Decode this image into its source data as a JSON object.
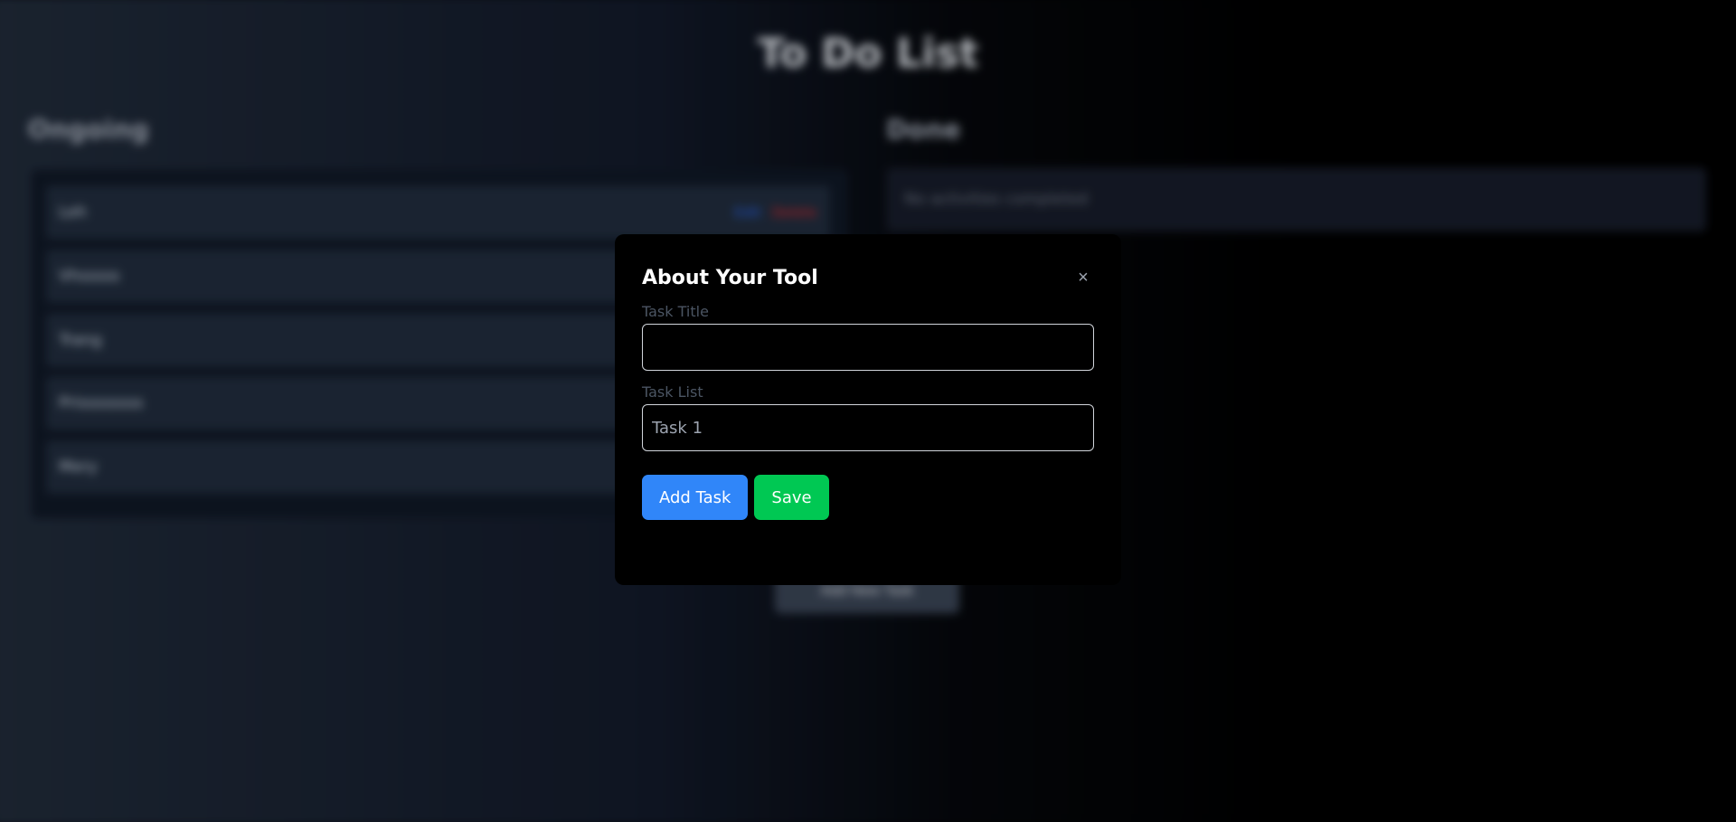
{
  "background": {
    "title": "To Do List",
    "ongoing": {
      "heading": "Ongoing",
      "tasks": [
        {
          "name": "Leh",
          "edit": "Edit",
          "delete": "Delete"
        },
        {
          "name": "Vhsssss"
        },
        {
          "name": "Trang"
        },
        {
          "name": "Prissssssss"
        },
        {
          "name": "Mery"
        }
      ]
    },
    "done": {
      "heading": "Done",
      "empty_text": "No activities completed"
    },
    "add_new_label": "Add New Task"
  },
  "modal": {
    "title": "About Your Tool",
    "close_icon": "×",
    "task_title_label": "Task Title",
    "task_title_value": "",
    "task_list_label": "Task List",
    "task_list_placeholder": "Task 1",
    "add_task_label": "Add Task",
    "save_label": "Save"
  },
  "colors": {
    "add_task": "#3086f9",
    "save": "#00c853",
    "edit": "#2563eb",
    "delete": "#dc2626"
  }
}
